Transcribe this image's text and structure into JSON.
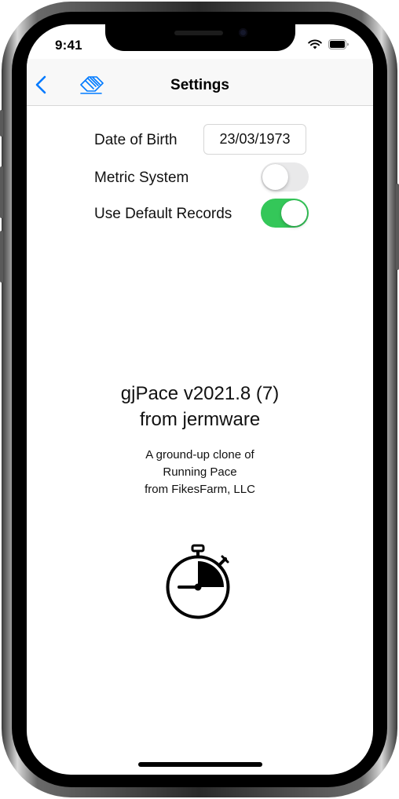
{
  "status_bar": {
    "time": "9:41",
    "icons": [
      "signal-icon",
      "wifi-icon",
      "battery-icon"
    ]
  },
  "nav": {
    "title": "Settings",
    "back_icon": "chevron-left-icon",
    "action_icon": "eraser-icon",
    "accent_color": "#007aff"
  },
  "settings": {
    "dob_label": "Date of Birth",
    "dob_value": "23/03/1973",
    "metric_label": "Metric System",
    "metric_on": false,
    "records_label": "Use Default Records",
    "records_on": true,
    "toggle_on_color": "#34c759"
  },
  "about": {
    "title_line1": "gjPace v2021.8 (7)",
    "title_line2": "from jermware",
    "desc_line1": "A ground-up clone of",
    "desc_line2": "Running Pace",
    "desc_line3": "from FikesFarm, LLC",
    "logo_icon": "stopwatch-icon"
  }
}
